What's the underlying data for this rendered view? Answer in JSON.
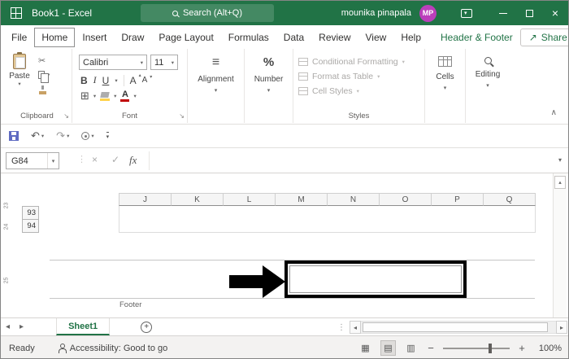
{
  "colors": {
    "accent": "#217346",
    "avatar": "#BB3FBB",
    "font_color": "#C00000"
  },
  "titlebar": {
    "title": "Book1 - Excel",
    "search": "Search (Alt+Q)",
    "user": "mounika pinapala",
    "initials": "MP"
  },
  "tabs": [
    "File",
    "Home",
    "Insert",
    "Draw",
    "Page Layout",
    "Formulas",
    "Data",
    "Review",
    "View",
    "Help",
    "Header & Footer"
  ],
  "share": "Share",
  "ribbon": {
    "paste": "Paste",
    "font_name": "Calibri",
    "font_size": "11",
    "bold": "B",
    "italic": "I",
    "underline": "U",
    "grow": "A",
    "shrink": "A",
    "font_color_letter": "A",
    "percent": "%",
    "styles_items": [
      "Conditional Formatting",
      "Format as Table",
      "Cell Styles"
    ],
    "groups": {
      "clipboard": "Clipboard",
      "font": "Font",
      "alignment": "Alignment",
      "number": "Number",
      "styles": "Styles",
      "cells": "Cells",
      "editing": "Editing"
    }
  },
  "formula_bar": {
    "name_box": "G84",
    "fx": "fx",
    "value": ""
  },
  "sheet": {
    "columns": [
      "J",
      "K",
      "L",
      "M",
      "N",
      "O",
      "P",
      "Q"
    ],
    "rows": [
      "93",
      "94"
    ],
    "ruler": [
      "23",
      "24",
      "25"
    ],
    "footer_label": "Footer"
  },
  "sheet_tabs": {
    "active": "Sheet1"
  },
  "status": {
    "mode": "Ready",
    "accessibility": "Accessibility: Good to go",
    "zoom": "100%"
  }
}
